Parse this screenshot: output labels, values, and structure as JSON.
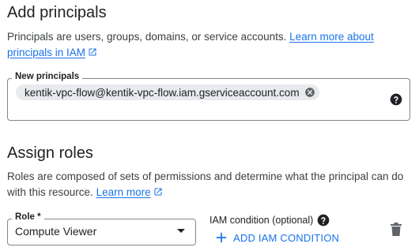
{
  "add_principals": {
    "title": "Add principals",
    "description": "Principals are users, groups, domains, or service accounts.",
    "learn_more_link": "Learn more about principals in IAM",
    "field_label": "New principals",
    "chip_value": "kentik-vpc-flow@kentik-vpc-flow.iam.gserviceaccount.com"
  },
  "assign_roles": {
    "title": "Assign roles",
    "description": "Roles are composed of sets of permissions and determine what the principal can do with this resource.",
    "learn_more_link": "Learn more",
    "role_label": "Role *",
    "role_value": "Compute Viewer",
    "iam_condition_label": "IAM condition (optional)",
    "add_condition_label": "ADD IAM CONDITION"
  },
  "icons": {
    "external_link": "open-in-new-icon",
    "chip_remove": "cancel-circle-icon",
    "help": "help-circle-icon",
    "dropdown": "arrow-drop-down-icon",
    "add": "plus-icon",
    "delete": "trash-icon"
  },
  "colors": {
    "link": "#1a73e8",
    "text": "#202124",
    "secondary_text": "#3c4043",
    "chip_bg": "#e8eaed",
    "outline": "#80868b",
    "icon_gray": "#5f6368"
  }
}
